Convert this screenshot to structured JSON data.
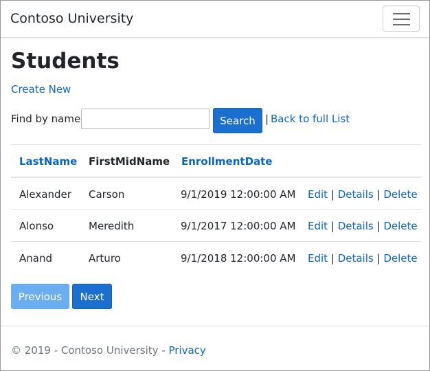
{
  "navbar": {
    "brand": "Contoso University",
    "menu_icon": "hamburger-menu-icon"
  },
  "page": {
    "title": "Students",
    "create_new": "Create New"
  },
  "search": {
    "label": "Find by name:",
    "value": "",
    "placeholder": "",
    "button_label": "Search",
    "separator": "|",
    "back_link": "Back to full List"
  },
  "table": {
    "headers": [
      {
        "label": "LastName",
        "sortable": true
      },
      {
        "label": "FirstMidName",
        "sortable": false
      },
      {
        "label": "EnrollmentDate",
        "sortable": true
      }
    ],
    "rows": [
      {
        "last": "Alexander",
        "first": "Carson",
        "date": "9/1/2019 12:00:00 AM"
      },
      {
        "last": "Alonso",
        "first": "Meredith",
        "date": "9/1/2017 12:00:00 AM"
      },
      {
        "last": "Anand",
        "first": "Arturo",
        "date": "9/1/2018 12:00:00 AM"
      }
    ],
    "actions": {
      "edit": "Edit",
      "details": "Details",
      "delete": "Delete",
      "separator": "|"
    }
  },
  "pagination": {
    "previous": "Previous",
    "next": "Next",
    "previous_disabled": true
  },
  "footer": {
    "copyright": "© 2019 - Contoso University -",
    "privacy": "Privacy"
  },
  "colors": {
    "link": "#0a66c2",
    "primary": "#1a6fcf",
    "primary_disabled": "#6aaef0",
    "muted": "#6c757d"
  }
}
